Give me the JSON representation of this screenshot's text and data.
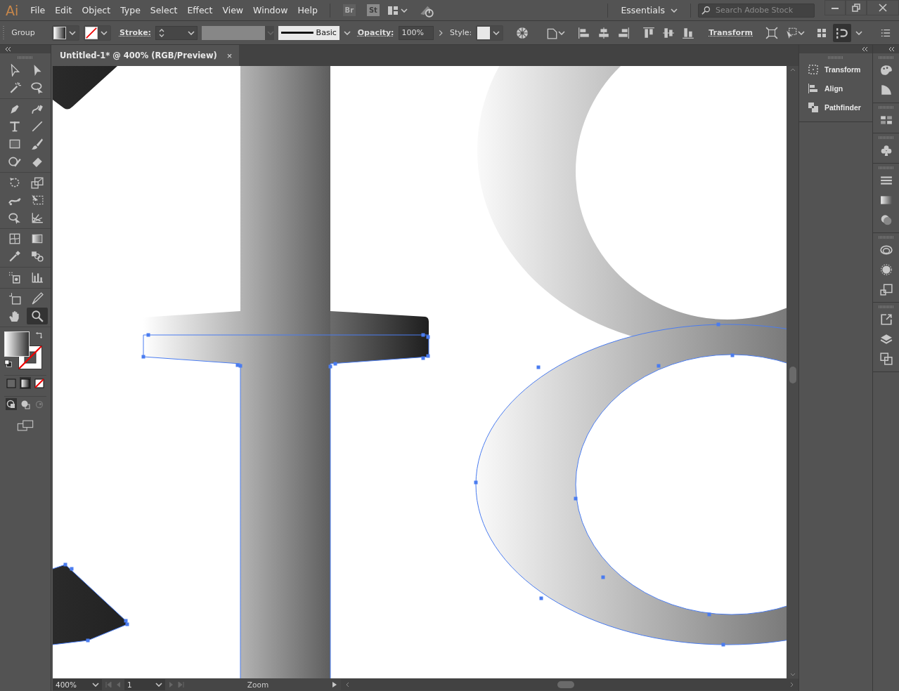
{
  "menu_bar": {
    "logo": "Ai",
    "items": [
      "File",
      "Edit",
      "Object",
      "Type",
      "Select",
      "Effect",
      "View",
      "Window",
      "Help"
    ],
    "bridge": "Br",
    "stock": "St",
    "workspace": "Essentials",
    "search": {
      "placeholder": "Search Adobe Stock"
    }
  },
  "control_bar": {
    "selection": "Group",
    "stroke_label": "Stroke:",
    "stroke_profile": "Basic",
    "opacity_label": "Opacity:",
    "opacity": "100%",
    "style_label": "Style:",
    "transform_link": "Transform"
  },
  "document_tab": {
    "title": "Untitled-1* @ 400% (RGB/Preview)",
    "close": "×"
  },
  "tools": [
    {
      "selected": false
    },
    {
      "selected": false
    },
    {
      "selected": false
    },
    {
      "selected": false
    },
    {
      "selected": false
    },
    {
      "selected": false
    },
    {
      "selected": false
    },
    {
      "selected": false
    },
    {
      "selected": false
    },
    {
      "selected": false
    },
    {
      "selected": false
    },
    {
      "selected": false
    },
    {
      "selected": false
    },
    {
      "selected": false
    },
    {
      "selected": false
    },
    {
      "selected": false
    },
    {
      "selected": false
    },
    {
      "selected": false
    },
    {
      "selected": false
    },
    {
      "selected": false
    },
    {
      "selected": false
    },
    {
      "selected": false
    },
    {
      "selected": false
    },
    {
      "selected": false
    },
    {
      "selected": false
    },
    {
      "selected": false
    },
    {
      "selected": false
    },
    {
      "selected": true
    }
  ],
  "panels": [
    {
      "label": "Transform"
    },
    {
      "label": "Align"
    },
    {
      "label": "Pathfinder"
    }
  ],
  "status_bar": {
    "zoom": "400%",
    "artboard": "1",
    "current_tool": "Zoom"
  }
}
